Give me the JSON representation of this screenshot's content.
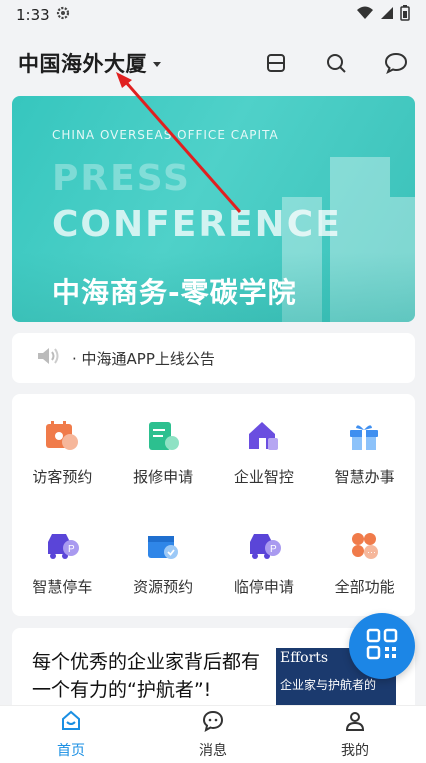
{
  "status": {
    "time": "1:33"
  },
  "header": {
    "title": "中国海外大厦"
  },
  "banner": {
    "subtitle": "CHINA OVERSEAS OFFICE CAPITA",
    "line1": "PRESS",
    "line2": "CONFERENCE",
    "cn_title": "中海商务-零碳学院"
  },
  "notice": {
    "text": "· 中海通APP上线公告"
  },
  "services": [
    {
      "label": "访客预约",
      "icon": "visitor-icon",
      "color": "#f07b4a"
    },
    {
      "label": "报修申请",
      "icon": "repair-icon",
      "color": "#2cc08f"
    },
    {
      "label": "企业智控",
      "icon": "home-control-icon",
      "color": "#6a4ee0"
    },
    {
      "label": "智慧办事",
      "icon": "gift-icon",
      "color": "#3f8ff0"
    },
    {
      "label": "智慧停车",
      "icon": "parking-icon",
      "color": "#5a45d8"
    },
    {
      "label": "资源预约",
      "icon": "resource-icon",
      "color": "#2f86e8"
    },
    {
      "label": "临停申请",
      "icon": "temp-parking-icon",
      "color": "#5a45d8"
    },
    {
      "label": "全部功能",
      "icon": "all-functions-icon",
      "color": "#f07b4a"
    }
  ],
  "article": {
    "headline": "每个优秀的企业家背后都有一个有力的“护航者”!",
    "thumb_line1": "Efforts",
    "thumb_line2": "企业家与护航者的"
  },
  "tabs": [
    {
      "label": "首页",
      "icon": "home-icon",
      "active": true
    },
    {
      "label": "消息",
      "icon": "message-icon",
      "active": false
    },
    {
      "label": "我的",
      "icon": "profile-icon",
      "active": false
    }
  ]
}
